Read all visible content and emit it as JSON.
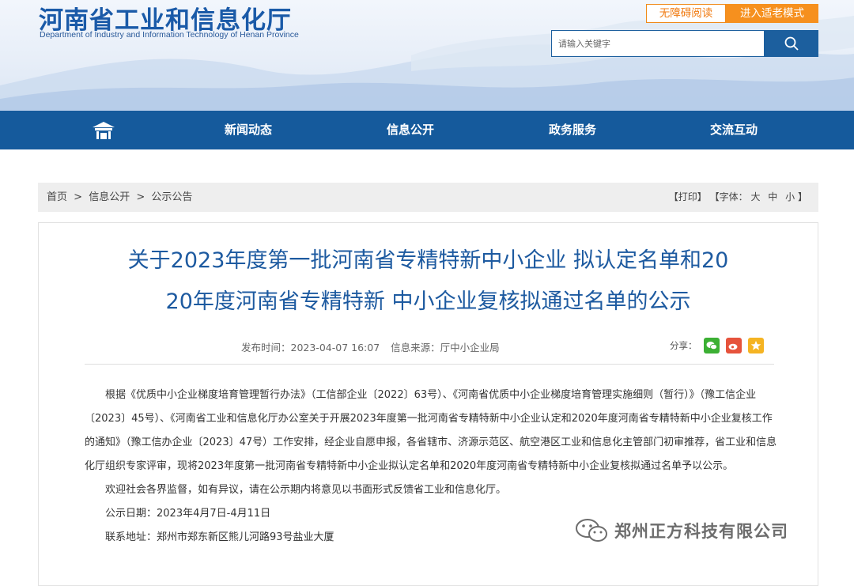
{
  "header": {
    "title": "河南省工业和信息化厅",
    "subtitle": "Department of Industry and Information Technology of Henan Province",
    "accessibility_label": "无障碍阅读",
    "elder_mode_label": "进入适老模式",
    "search": {
      "placeholder": "请输入关键字",
      "icon": "search-icon"
    }
  },
  "nav": {
    "home_icon": "home-icon",
    "items": [
      "新闻动态",
      "信息公开",
      "政务服务",
      "交流互动"
    ]
  },
  "breadcrumb": {
    "items": [
      "首页",
      ">",
      "信息公开",
      ">",
      "公示公告"
    ],
    "print": "【打印】",
    "font_size_label": "【字体：",
    "font_sizes": [
      "大",
      "中",
      "小"
    ],
    "font_close": "】"
  },
  "article": {
    "title_line1": "关于2023年度第一批河南省专精特新中小企业 拟认定名单和20",
    "title_line2": "20年度河南省专精特新 中小企业复核拟通过名单的公示",
    "publish_time": "发布时间：2023-04-07 16:07",
    "source": "信息来源：厅中小企业局",
    "share_label": "分享：",
    "share_icons": [
      "wechat-icon",
      "weibo-icon",
      "qzone-icon"
    ],
    "paragraph1": "根据《优质中小企业梯度培育管理暂行办法》（工信部企业〔2022〕63号）、《河南省优质中小企业梯度培育管理实施细则（暂行）》（豫工信企业〔2023〕45号）、《河南省工业和信息化厅办公室关于开展2023年度第一批河南省专精特新中小企业认定和2020年度河南省专精特新中小企业复核工作的通知》（豫工信办企业〔2023〕47号）工作安排，经企业自愿申报，各省辖市、济源示范区、航空港区工业和信息化主管部门初审推荐，省工业和信息化厅组织专家评审，现将2023年度第一批河南省专精特新中小企业拟认定名单和2020年度河南省专精特新中小企业复核拟通过名单予以公示。",
    "paragraph2": "欢迎社会各界监督，如有异议，请在公示期内将意见以书面形式反馈省工业和信息化厅。",
    "period": "公示日期：2023年4月7日-4月11日",
    "address": "联系地址：郑州市郑东新区熊儿河路93号盐业大厦"
  },
  "watermark": {
    "text": "郑州正方科技有限公司",
    "icon": "wechat-icon"
  },
  "colors": {
    "brand_blue": "#155a9c",
    "title_blue": "#1d5aa0",
    "orange": "#f6901e"
  }
}
